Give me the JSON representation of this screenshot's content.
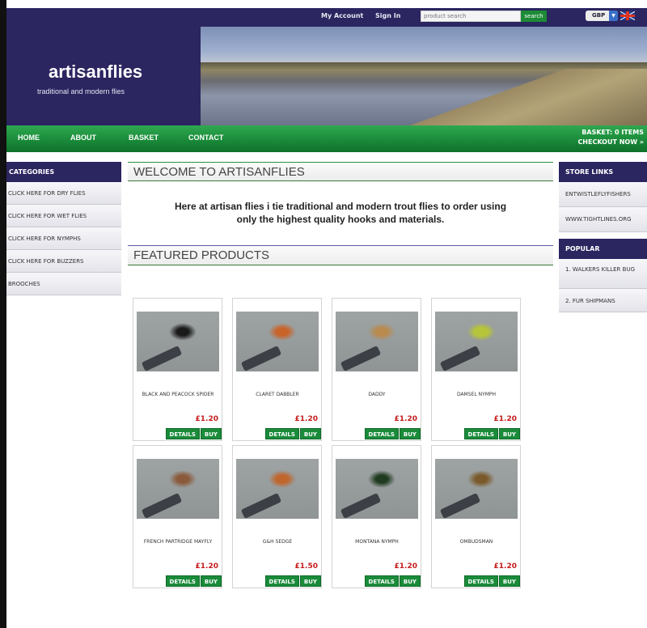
{
  "header": {
    "site_title": "artisanflies",
    "tagline": "traditional and modern flies",
    "my_account": "My Account",
    "sign_in": "Sign In",
    "search_placeholder": "product search",
    "search_button": "search",
    "currency": "GBP"
  },
  "nav": {
    "items": [
      "HOME",
      "ABOUT",
      "BASKET",
      "CONTACT"
    ],
    "basket_status": "BASKET: 0 ITEMS",
    "checkout": "CHECKOUT NOW »"
  },
  "categories": {
    "title": "CATEGORIES",
    "items": [
      "CLICK HERE FOR DRY FLIES",
      "CLICK HERE FOR WET FLIES",
      "CLICK HERE FOR NYMPHS",
      "CLICK HERE FOR BUZZERS",
      "BROOCHES"
    ]
  },
  "store_links": {
    "title": "STORE LINKS",
    "items": [
      "ENTWISTLEFLYFISHERS",
      "WWW.TIGHTLINES.ORG"
    ]
  },
  "popular": {
    "title": "POPULAR",
    "items": [
      "1. WALKERS KILLER BUG",
      "2. FUR SHIPMANS"
    ]
  },
  "main": {
    "welcome_title": "WELCOME TO ARTISANFLIES",
    "welcome_text": "Here at artisan flies i tie traditional and modern trout flies to order using only the highest quality hooks and materials.",
    "featured_title": "FEATURED PRODUCTS",
    "details_label": "DETAILS",
    "buy_label": "BUY",
    "products": [
      {
        "name": "BLACK AND PEACOCK SPIDER",
        "price": "£1.20"
      },
      {
        "name": "CLARET DABBLER",
        "price": "£1.20"
      },
      {
        "name": "DADDY",
        "price": "£1.20"
      },
      {
        "name": "DAMSEL NYMPH",
        "price": "£1.20"
      },
      {
        "name": "FRENCH PARTRIDGE MAYFLY",
        "price": "£1.20"
      },
      {
        "name": "G&H SEDGE",
        "price": "£1.50"
      },
      {
        "name": "MONTANA NYMPH",
        "price": "£1.20"
      },
      {
        "name": "OMBUDSMAN",
        "price": "£1.20"
      }
    ]
  },
  "colors": {
    "header_bg": "#2b2560",
    "nav_green": "#1a8b3a",
    "price_red": "#c51a1a"
  }
}
